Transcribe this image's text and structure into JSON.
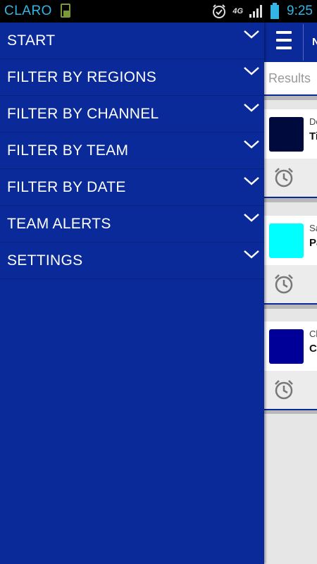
{
  "status_bar": {
    "carrier": "CLARO",
    "network": "4G",
    "time": "9:25",
    "icons": [
      "sim-card-icon",
      "alarm-clock-icon",
      "network-4g-icon",
      "signal-icon",
      "battery-icon"
    ]
  },
  "drawer": {
    "items": [
      {
        "label": "START",
        "icon": "chevron-down-icon"
      },
      {
        "label": "FILTER BY REGIONS",
        "icon": "chevron-down-icon"
      },
      {
        "label": "FILTER BY CHANNEL",
        "icon": "chevron-down-icon"
      },
      {
        "label": "FILTER BY TEAM",
        "icon": "chevron-down-icon"
      },
      {
        "label": "FILTER BY DATE",
        "icon": "chevron-down-icon"
      },
      {
        "label": "TEAM ALERTS",
        "icon": "chevron-down-icon"
      },
      {
        "label": "SETTINGS",
        "icon": "chevron-down-icon"
      }
    ]
  },
  "app": {
    "toolbar": {
      "menu_icon": "hamburger-menu-icon",
      "title_fragment": "N"
    },
    "search": {
      "placeholder": "Results"
    },
    "cards": [
      {
        "subtitle": "De",
        "title": "Ti",
        "color": "#000a3c",
        "icon": "alarm-clock-icon"
      },
      {
        "subtitle": "Sa",
        "title": "Pa",
        "color": "#00ffff",
        "icon": "alarm-clock-icon"
      },
      {
        "subtitle": "Cl",
        "title": "C",
        "color": "#000099",
        "icon": "alarm-clock-icon"
      }
    ]
  },
  "colors": {
    "drawer_bg": "#0a2a9a",
    "status_text": "#33b5e5",
    "card_accent": "#0a2a9a"
  }
}
